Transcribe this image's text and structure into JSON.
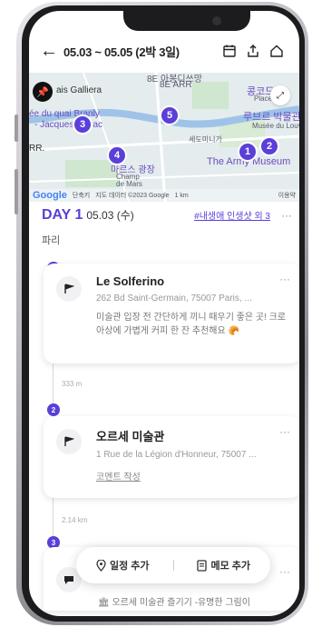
{
  "header": {
    "title": "05.03 ~ 05.05 (2박 3일)",
    "back_icon": "back-arrow-icon",
    "icons": [
      "calendar-icon",
      "share-icon",
      "home-icon"
    ]
  },
  "map": {
    "labels": {
      "top": "8E ARR",
      "top2": "8E 아봉디쓰망",
      "galleria": "ais Galliera",
      "quai": "ée du quai Branly",
      "chirac": "- Jacques Chirac",
      "arr": "RR.",
      "kokord": "콩코드",
      "concorde": "Place de l",
      "louvre1": "루브르 박물관",
      "louvre2": "Musée du Louvre",
      "army": "The Army Museum",
      "champ": "마르스 광장",
      "champ2": "Champ",
      "champ3": "de Mars",
      "sevel": "세도미니가"
    },
    "markers": [
      "1",
      "2",
      "3",
      "4",
      "5"
    ],
    "footer": {
      "google": "Google",
      "shortcut": "단축키",
      "mapdata": "지도 데이터 ©2023 Google",
      "scale": "1 km",
      "terms": "이용약"
    }
  },
  "day": {
    "label": "DAY 1",
    "date": "05.03 (수)",
    "tag": "#내생애 인생샷 외 3",
    "more": "···",
    "city": "파리"
  },
  "items": [
    {
      "num": "1",
      "title": "Le Solferino",
      "address": "262 Bd Saint-Germain, 75007 Paris, ...",
      "memo": "미술관 입장 전 간단하게 끼니 때우기 좋은 곳! 크로아상에 가볍게 커피 한 잔 추천해요",
      "memo_emoji": "🥐",
      "more": "···"
    },
    {
      "num": "2",
      "title": "오르세 미술관",
      "address": "1 Rue de la Légion d'Honneur, 75007 ...",
      "link": "코멘트 작성",
      "more": "···"
    },
    {
      "num": "3",
      "text": "오르세 미술관 즐기기 -유명한 그림이",
      "more": "···"
    }
  ],
  "distances": [
    "333 m",
    "2.14 km"
  ],
  "fab": {
    "add_schedule": "일정 추가",
    "add_memo": "메모 추가"
  }
}
